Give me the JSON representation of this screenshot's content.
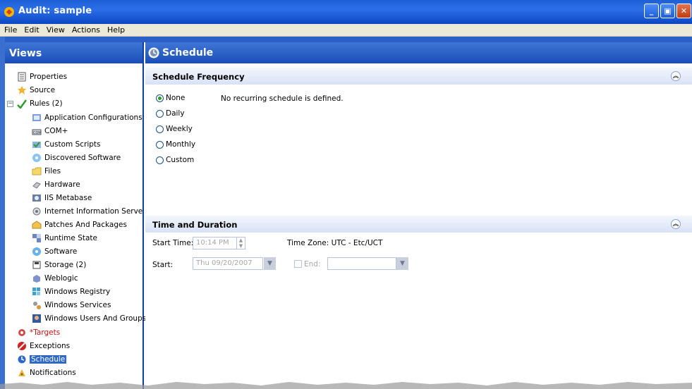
{
  "window": {
    "title": "Audit: sample",
    "controls": [
      "minimize",
      "maximize",
      "close"
    ]
  },
  "menu": {
    "items": [
      "File",
      "Edit",
      "View",
      "Actions",
      "Help"
    ]
  },
  "views": {
    "title": "Views",
    "tree": [
      {
        "label": "Properties",
        "icon": "properties-icon",
        "level": 0
      },
      {
        "label": "Source",
        "icon": "source-icon",
        "level": 0
      },
      {
        "label": "Rules (2)",
        "icon": "rules-icon",
        "level": 0,
        "expander": "⊟"
      },
      {
        "label": "Application Configurations",
        "icon": "app-config-icon",
        "level": 1
      },
      {
        "label": "COM+",
        "icon": "com-icon",
        "level": 1
      },
      {
        "label": "Custom Scripts",
        "icon": "custom-scripts-icon",
        "level": 1
      },
      {
        "label": "Discovered Software",
        "icon": "discovered-software-icon",
        "level": 1
      },
      {
        "label": "Files",
        "icon": "folder-icon",
        "level": 1
      },
      {
        "label": "Hardware",
        "icon": "hardware-icon",
        "level": 1
      },
      {
        "label": "IIS Metabase",
        "icon": "iis-metabase-icon",
        "level": 1
      },
      {
        "label": "Internet Information Serve",
        "icon": "iis-icon",
        "level": 1
      },
      {
        "label": "Patches And Packages",
        "icon": "patches-icon",
        "level": 1
      },
      {
        "label": "Runtime State",
        "icon": "runtime-state-icon",
        "level": 1
      },
      {
        "label": "Software",
        "icon": "software-icon",
        "level": 1
      },
      {
        "label": "Storage (2)",
        "icon": "storage-icon",
        "level": 1
      },
      {
        "label": "Weblogic",
        "icon": "weblogic-icon",
        "level": 1
      },
      {
        "label": "Windows Registry",
        "icon": "registry-icon",
        "level": 1
      },
      {
        "label": "Windows Services",
        "icon": "services-icon",
        "level": 1
      },
      {
        "label": "Windows Users And Groups",
        "icon": "users-groups-icon",
        "level": 1
      },
      {
        "label": "*Targets",
        "icon": "targets-icon",
        "level": 0,
        "color": "#cc1111"
      },
      {
        "label": "Exceptions",
        "icon": "exceptions-icon",
        "level": 0
      },
      {
        "label": "Schedule",
        "icon": "schedule-icon",
        "level": 0,
        "selected": true
      },
      {
        "label": "Notifications",
        "icon": "notifications-icon",
        "level": 0
      }
    ]
  },
  "schedule": {
    "title": "Schedule",
    "frequency": {
      "title": "Schedule Frequency",
      "options": [
        "None",
        "Daily",
        "Weekly",
        "Monthly",
        "Custom"
      ],
      "selected": "None",
      "message": "No recurring schedule is defined."
    },
    "time": {
      "title": "Time and Duration",
      "start_time_label": "Start Time:",
      "start_time_value": "10:14 PM",
      "time_zone_label": "Time Zone:",
      "time_zone_value": "UTC - Etc/UCT",
      "start_label": "Start:",
      "start_value": "Thu 09/20/2007",
      "end_label": "End:",
      "end_value": ""
    }
  },
  "colors": {
    "titlebar": "#2b6fe8",
    "pane_header": "#2a5fc8",
    "selection": "#316ac5",
    "targets": "#cc1111"
  }
}
